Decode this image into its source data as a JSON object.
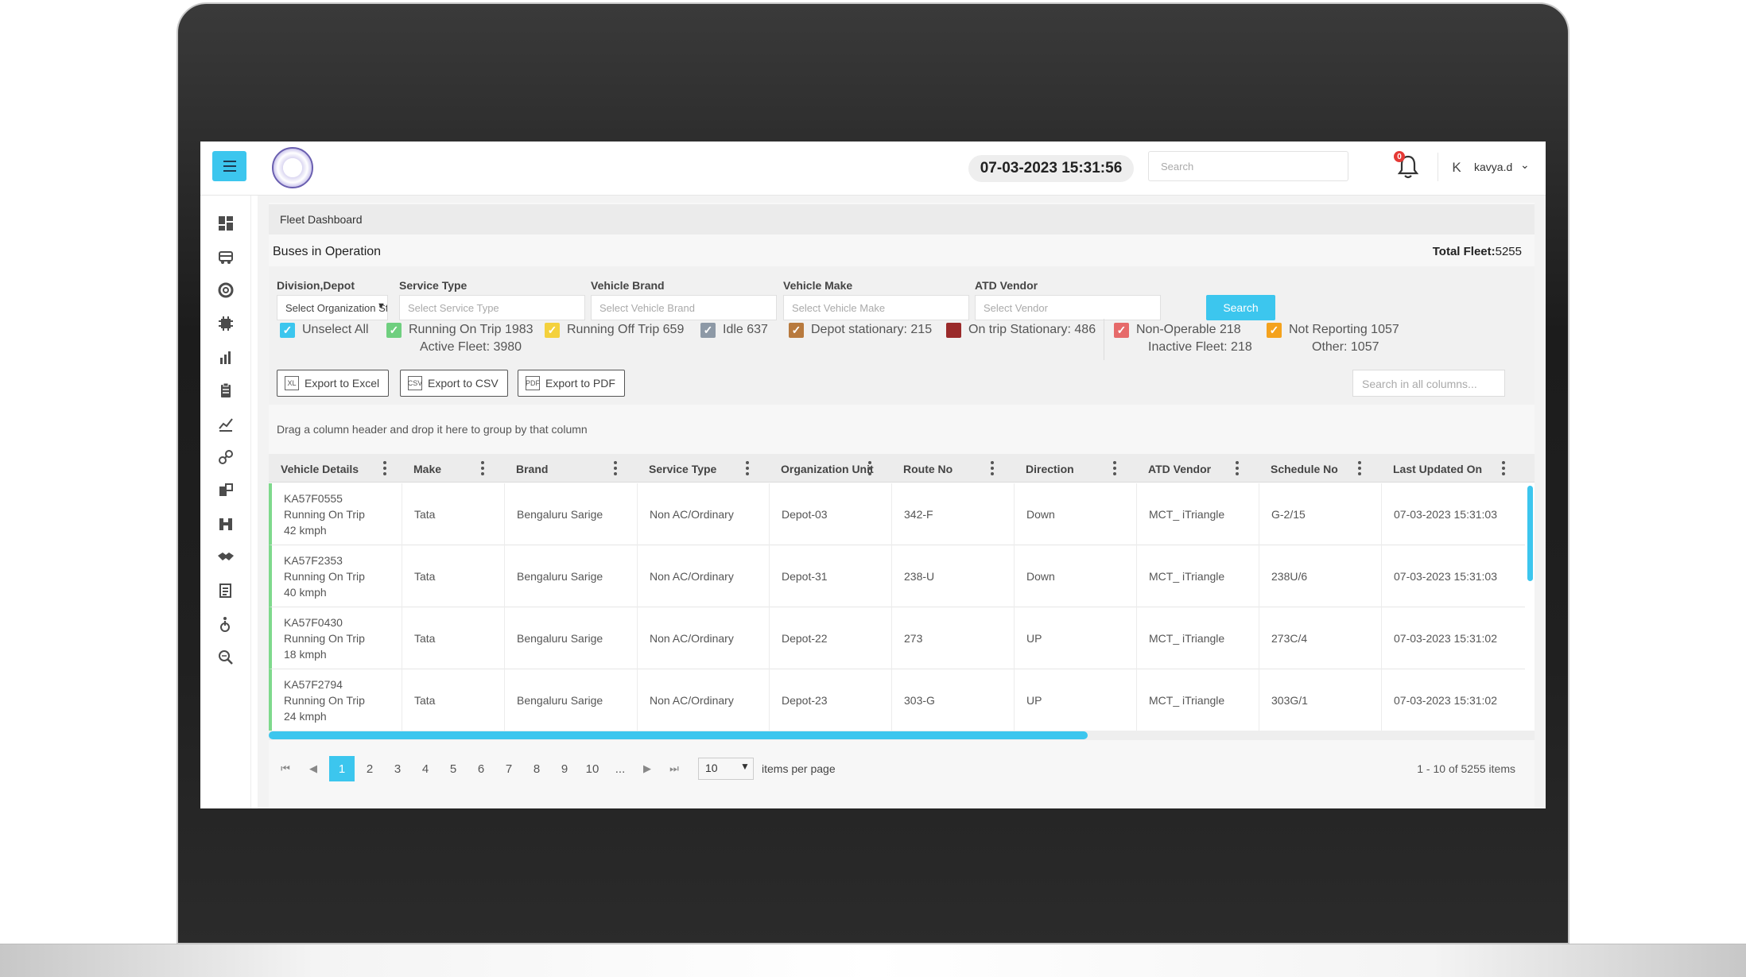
{
  "header": {
    "datetime": "07-03-2023 15:31:56",
    "search_placeholder": "Search",
    "notification_count": "0",
    "avatar_letter": "K",
    "username": "kavya.d"
  },
  "sidebar": {
    "icons": [
      "dashboard-icon",
      "bus-icon",
      "support-icon",
      "chip-icon",
      "bar-chart-icon",
      "clipboard-icon",
      "analytics-icon",
      "route-icon",
      "depot-icon",
      "fleet-map-icon",
      "handshake-icon",
      "report-icon",
      "accessibility-icon",
      "zoom-icon"
    ]
  },
  "page": {
    "breadcrumb": "Fleet Dashboard",
    "title": "Buses in Operation",
    "total_fleet_label": "Total Fleet:",
    "total_fleet_value": "5255"
  },
  "filters": {
    "division": {
      "label": "Division,Depot",
      "value": "Select Organization Str..."
    },
    "service_type": {
      "label": "Service Type",
      "placeholder": "Select Service Type"
    },
    "vehicle_brand": {
      "label": "Vehicle Brand",
      "placeholder": "Select Vehicle Brand"
    },
    "vehicle_make": {
      "label": "Vehicle Make",
      "placeholder": "Select Vehicle Make"
    },
    "atd_vendor": {
      "label": "ATD Vendor",
      "placeholder": "Select Vendor"
    },
    "search_button": "Search"
  },
  "legend": {
    "items": [
      {
        "label": "Unselect All",
        "color": "#3cc6ee"
      },
      {
        "label": "Running On Trip 1983",
        "color": "#6fcf7f"
      },
      {
        "label": "Running Off Trip 659",
        "color": "#f4d13d"
      },
      {
        "label": "Idle 637",
        "color": "#8d99a6"
      },
      {
        "label": "Depot stationary: 215",
        "color": "#b87a3e"
      },
      {
        "label": "On trip Stationary: 486",
        "color": "#9a2a2a"
      },
      {
        "label": "Non-Operable 218",
        "color": "#e66a6a"
      },
      {
        "label": "Not Reporting 1057",
        "color": "#f4a21d"
      }
    ],
    "active_fleet": "Active Fleet: 3980",
    "inactive_fleet": "Inactive Fleet: 218",
    "other": "Other: 1057"
  },
  "toolbar": {
    "export_excel": "Export to Excel",
    "export_csv": "Export to CSV",
    "export_pdf": "Export to PDF",
    "column_search_placeholder": "Search in all columns..."
  },
  "grid": {
    "group_hint": "Drag a column header and drop it here to group by that column",
    "columns": [
      "Vehicle Details",
      "Make",
      "Brand",
      "Service Type",
      "Organization Unit",
      "Route No",
      "Direction",
      "ATD Vendor",
      "Schedule No",
      "Last Updated On"
    ],
    "rows": [
      {
        "vehicle": "KA57F0555",
        "status": "Running On Trip",
        "speed": "42 kmph",
        "make": "Tata",
        "brand": "Bengaluru Sarige",
        "service": "Non AC/Ordinary",
        "org": "Depot-03",
        "route": "342-F",
        "direction": "Down",
        "vendor": "MCT_ iTriangle",
        "schedule": "G-2/15",
        "updated": "07-03-2023 15:31:03"
      },
      {
        "vehicle": "KA57F2353",
        "status": "Running On Trip",
        "speed": "40 kmph",
        "make": "Tata",
        "brand": "Bengaluru Sarige",
        "service": "Non AC/Ordinary",
        "org": "Depot-31",
        "route": "238-U",
        "direction": "Down",
        "vendor": "MCT_ iTriangle",
        "schedule": "238U/6",
        "updated": "07-03-2023 15:31:03"
      },
      {
        "vehicle": "KA57F0430",
        "status": "Running On Trip",
        "speed": "18 kmph",
        "make": "Tata",
        "brand": "Bengaluru Sarige",
        "service": "Non AC/Ordinary",
        "org": "Depot-22",
        "route": "273",
        "direction": "UP",
        "vendor": "MCT_ iTriangle",
        "schedule": "273C/4",
        "updated": "07-03-2023 15:31:02"
      },
      {
        "vehicle": "KA57F2794",
        "status": "Running On Trip",
        "speed": "24 kmph",
        "make": "Tata",
        "brand": "Bengaluru Sarige",
        "service": "Non AC/Ordinary",
        "org": "Depot-23",
        "route": "303-G",
        "direction": "UP",
        "vendor": "MCT_ iTriangle",
        "schedule": "303G/1",
        "updated": "07-03-2023 15:31:02"
      }
    ]
  },
  "pager": {
    "pages": [
      "1",
      "2",
      "3",
      "4",
      "5",
      "6",
      "7",
      "8",
      "9",
      "10",
      "..."
    ],
    "current_page": "1",
    "per_page": "10",
    "per_page_label": "items per page",
    "range": "1 - 10 of 5255 items"
  }
}
